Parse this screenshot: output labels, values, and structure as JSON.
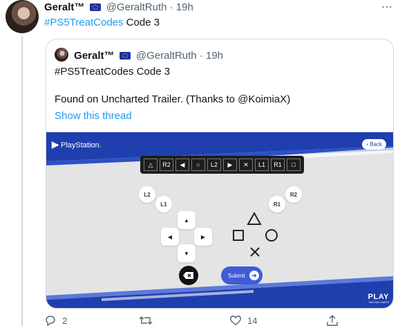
{
  "tweet": {
    "display_name": "Geralt™",
    "handle": "@GeraltRuth",
    "time_sep": "·",
    "time": "19h",
    "hashtag": "#PS5TreatCodes",
    "text_after_hashtag": " Code 3",
    "more_icon": "⋯"
  },
  "quoted": {
    "display_name": "Geralt™",
    "handle": "@GeraltRuth",
    "time_sep": "·",
    "time": "19h",
    "line1": "#PS5TreatCodes Code 3",
    "line2": "Found on Uncharted Trailer. (Thanks to @KoimiaX)",
    "show_thread": "Show this thread",
    "media": {
      "brand_glyph": "▶",
      "brand_text": "PlayStation.",
      "back_label": "‹ Back",
      "code_sequence": [
        "△",
        "R2",
        "◀",
        "○",
        "L2",
        "▶",
        "✕",
        "L1",
        "R1",
        "□"
      ],
      "shoulder_left": [
        "L2",
        "L1"
      ],
      "shoulder_right": [
        "R2",
        "R1"
      ],
      "dpad": [
        "▲",
        "◀",
        "▶",
        "▼"
      ],
      "submit_label": "Submit",
      "submit_arrow": "➜",
      "delete_glyph": "✕",
      "play_big": "PLAY",
      "play_small": "HAS NO LIMITS"
    }
  },
  "actions": {
    "reply_count": "2",
    "retweet_count": "",
    "like_count": "14"
  }
}
